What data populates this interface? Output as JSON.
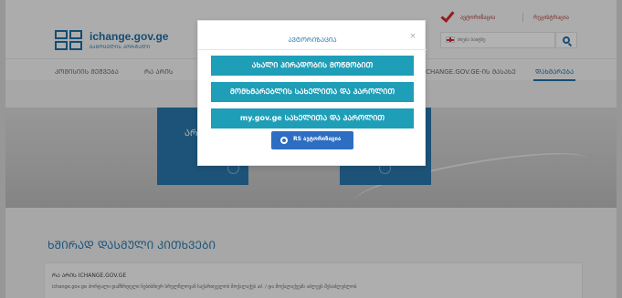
{
  "header": {
    "site_title": "ichange.gov.ge",
    "site_subtitle": "ᲒᲐᲛᲝᲪᲕᲚᲘᲡ ᲞᲝᲠᲢᲐᲚᲘ",
    "top_links": [
      "ავტორიზაცია",
      "რეგისტრაცია"
    ],
    "search": {
      "placeholder": "ძიება საიტზე"
    },
    "icons": {
      "logo": "logo-icon",
      "auth": "check-icon",
      "lang": "georgian-flag-icon",
      "search": "search-icon"
    }
  },
  "nav": {
    "items": [
      {
        "label": "ᲙᲝᲛᲘᲡᲘᲘᲡ ᲛᲔᲨᲕᲔᲑᲐ"
      },
      {
        "label": "ᲠᲐ ᲐᲠᲘᲡ"
      },
      {
        "label": "ICHANGE.GOV.GE-ᲘᲡ ᲛᲐᲡᲐᲮᲔ"
      },
      {
        "label": "ᲓᲐᲮᲛᲐᲠᲔᲑᲐ"
      }
    ],
    "active_index": 3
  },
  "hero": {
    "tile_text": "ᲐᲠ"
  },
  "faq": {
    "title": "ᲮᲨᲘᲠᲐᲓ ᲓᲐᲡᲛᲣᲚᲘ ᲙᲘᲗᲮᲕᲔᲑᲘ",
    "card_title": "ᲠᲐ ᲐᲠᲘᲡ ICHANGE.GOV.GE",
    "card_text": "ichange.gov.ge პორტალი დამზრდელი ნებისმიერ სრულწლოვან საქართველოს მოქალაქეს აძ. / და მოქალაქეებს აძლევს შესაძლებლობ"
  },
  "modal": {
    "title": "ᲐᲕᲢᲝᲠᲘᲖᲐᲪᲘᲐ",
    "close_label": "×",
    "buttons": [
      "ᲐᲮᲐᲚᲘ ᲞᲘᲠᲐᲓᲝᲑᲘᲡ ᲛᲝᲬᲛᲝᲑᲘᲗ",
      "ᲛᲝᲛᲮᲛᲐᲠᲔᲑᲚᲘᲡ ᲡᲐᲮᲔᲚᲘᲗᲐ ᲓᲐ ᲞᲐᲠᲝᲚᲘᲗ",
      "my.gov.ge ᲡᲐᲮᲔᲚᲘᲗᲐ ᲓᲐ ᲞᲐᲠᲝᲚᲘᲗ"
    ],
    "rs_button": "RS ავტორიზაცია",
    "colors": {
      "primary_button": "#1f9eb8",
      "rs_button": "#2d6ec3",
      "title": "#2a78ad"
    }
  }
}
